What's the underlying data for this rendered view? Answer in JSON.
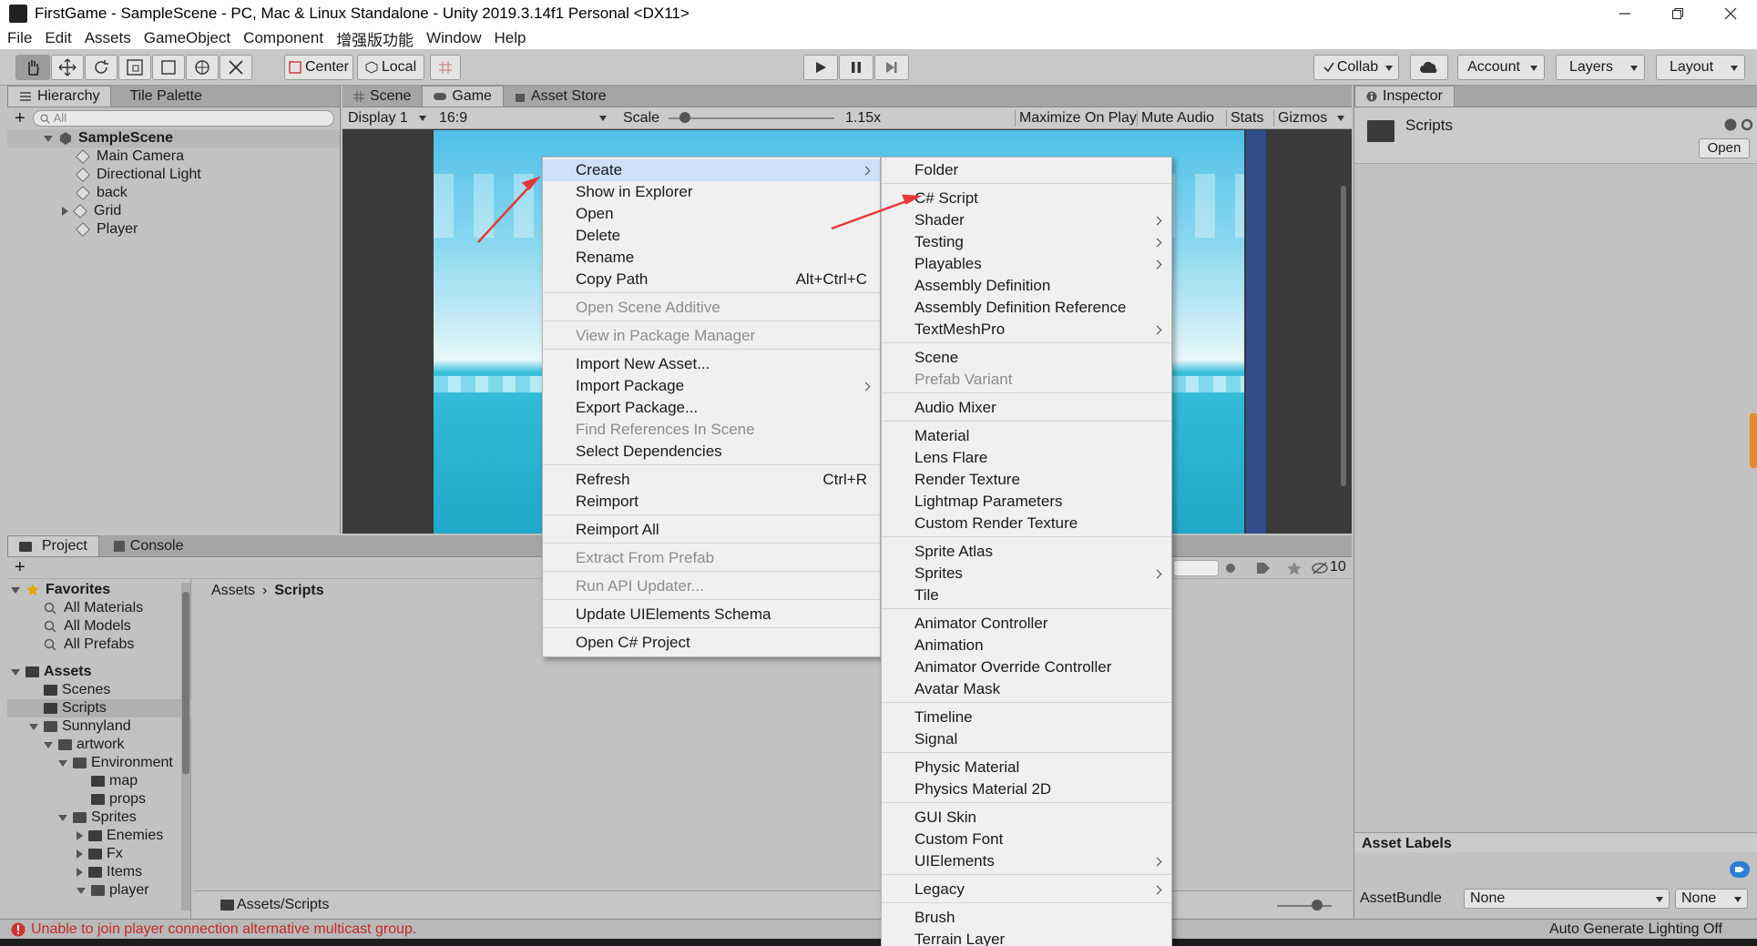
{
  "window": {
    "title": "FirstGame - SampleScene - PC, Mac & Linux Standalone - Unity 2019.3.14f1 Personal <DX11>"
  },
  "menubar": [
    "File",
    "Edit",
    "Assets",
    "GameObject",
    "Component",
    "增强版功能",
    "Window",
    "Help"
  ],
  "toolbar": {
    "pivot_center": "Center",
    "pivot_local": "Local",
    "collab": "Collab",
    "account": "Account",
    "layers": "Layers",
    "layout": "Layout"
  },
  "hierarchy": {
    "tabs": [
      "Hierarchy",
      "Tile Palette"
    ],
    "search_placeholder": "All",
    "scene": "SampleScene",
    "items": [
      "Main Camera",
      "Directional Light",
      "back",
      "Grid",
      "Player"
    ]
  },
  "game_view": {
    "tabs": [
      "Scene",
      "Game",
      "Asset Store"
    ],
    "display": "Display 1",
    "aspect": "16:9",
    "scale_label": "Scale",
    "scale_value": "1.15x",
    "scale_level": 0.1,
    "buttons": [
      "Maximize On Play",
      "Mute Audio",
      "Stats",
      "Gizmos"
    ]
  },
  "inspector": {
    "tab": "Inspector",
    "object_name": "Scripts",
    "open_button": "Open",
    "asset_labels": "Asset Labels",
    "assetbundle_label": "AssetBundle",
    "assetbundle_value": "None",
    "assetbundle_variant": "None"
  },
  "project": {
    "tabs": [
      "Project",
      "Console"
    ],
    "favorites_label": "Favorites",
    "favorites": [
      "All Materials",
      "All Models",
      "All Prefabs"
    ],
    "assets_label": "Assets",
    "folders": [
      "Scenes",
      "Scripts",
      "Sunnyland",
      "artwork",
      "Environment",
      "map",
      "props",
      "Sprites",
      "Enemies",
      "Fx",
      "Items",
      "player"
    ],
    "breadcrumb": [
      "Assets",
      "Scripts"
    ],
    "bottom_path": "Assets/Scripts",
    "hidden_count": "10"
  },
  "context_menu": {
    "items": [
      {
        "label": "Create",
        "sub": true,
        "highlighted": true
      },
      {
        "label": "Show in Explorer"
      },
      {
        "label": "Open"
      },
      {
        "label": "Delete"
      },
      {
        "label": "Rename"
      },
      {
        "label": "Copy Path",
        "shortcut": "Alt+Ctrl+C"
      },
      {
        "label": "Open Scene Additive",
        "disabled": true
      },
      {
        "label": "View in Package Manager",
        "disabled": true
      },
      {
        "label": "Import New Asset..."
      },
      {
        "label": "Import Package",
        "sub": true
      },
      {
        "label": "Export Package..."
      },
      {
        "label": "Find References In Scene",
        "disabled": true
      },
      {
        "label": "Select Dependencies"
      },
      {
        "label": "Refresh",
        "shortcut": "Ctrl+R"
      },
      {
        "label": "Reimport"
      },
      {
        "label": "Reimport All"
      },
      {
        "label": "Extract From Prefab",
        "disabled": true
      },
      {
        "label": "Run API Updater...",
        "disabled": true
      },
      {
        "label": "Update UIElements Schema"
      },
      {
        "label": "Open C# Project"
      }
    ]
  },
  "create_submenu": {
    "items": [
      {
        "label": "Folder"
      },
      {
        "label": "C# Script"
      },
      {
        "label": "Shader",
        "sub": true
      },
      {
        "label": "Testing",
        "sub": true
      },
      {
        "label": "Playables",
        "sub": true
      },
      {
        "label": "Assembly Definition"
      },
      {
        "label": "Assembly Definition Reference"
      },
      {
        "label": "TextMeshPro",
        "sub": true
      },
      {
        "label": "Scene"
      },
      {
        "label": "Prefab Variant",
        "disabled": true
      },
      {
        "label": "Audio Mixer"
      },
      {
        "label": "Material"
      },
      {
        "label": "Lens Flare"
      },
      {
        "label": "Render Texture"
      },
      {
        "label": "Lightmap Parameters"
      },
      {
        "label": "Custom Render Texture"
      },
      {
        "label": "Sprite Atlas"
      },
      {
        "label": "Sprites",
        "sub": true
      },
      {
        "label": "Tile"
      },
      {
        "label": "Animator Controller"
      },
      {
        "label": "Animation"
      },
      {
        "label": "Animator Override Controller"
      },
      {
        "label": "Avatar Mask"
      },
      {
        "label": "Timeline"
      },
      {
        "label": "Signal"
      },
      {
        "label": "Physic Material"
      },
      {
        "label": "Physics Material 2D"
      },
      {
        "label": "GUI Skin"
      },
      {
        "label": "Custom Font"
      },
      {
        "label": "UIElements",
        "sub": true
      },
      {
        "label": "Legacy",
        "sub": true
      },
      {
        "label": "Brush"
      },
      {
        "label": "Terrain Layer"
      }
    ]
  },
  "status": {
    "error": "Unable to join player connection alternative multicast group.",
    "lighting": "Auto Generate Lighting Off"
  },
  "colors": {
    "highlight": "#cde0f7",
    "error": "#c62828",
    "annotation_arrow": "#e53935",
    "sky": "#7fd3ec"
  }
}
